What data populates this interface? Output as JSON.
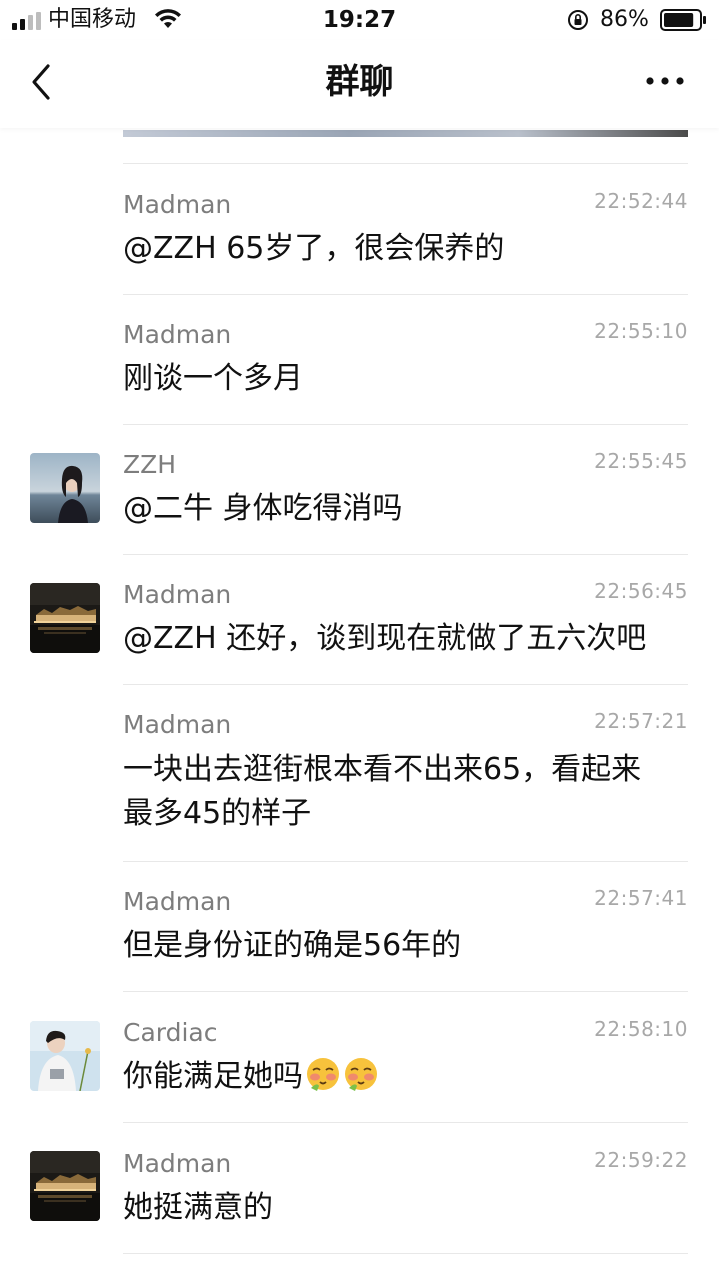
{
  "status_bar": {
    "carrier": "中国移动",
    "time": "19:27",
    "battery_percent": "86%",
    "battery_level": 0.86
  },
  "nav": {
    "title": "群聊",
    "back_icon": "chevron-left-icon",
    "more_icon": "more-dots-icon"
  },
  "messages": [
    {
      "sender": "Madman",
      "time": "22:52:44",
      "text": "@ZZH 65岁了，很会保养的",
      "avatar": "none"
    },
    {
      "sender": "Madman",
      "time": "22:55:10",
      "text": "刚谈一个多月",
      "avatar": "none"
    },
    {
      "sender": "ZZH",
      "time": "22:55:45",
      "text": "@二牛 身体吃得消吗",
      "avatar": "girl-beach-photo"
    },
    {
      "sender": "Madman",
      "time": "22:56:45",
      "text": "@ZZH 还好，谈到现在就做了五六次吧",
      "avatar": "night-palace-photo"
    },
    {
      "sender": "Madman",
      "time": "22:57:21",
      "text_line1": "一块出去逛街根本看不出来65，看起来",
      "text_line2": "最多45的样子",
      "avatar": "none"
    },
    {
      "sender": "Madman",
      "time": "22:57:41",
      "text": "但是身份证的确是56年的",
      "avatar": "none"
    },
    {
      "sender": "Cardiac",
      "time": "22:58:10",
      "text": "你能满足她吗",
      "emoji": [
        "blushing-emoji",
        "blushing-emoji"
      ],
      "avatar": "boy-photo"
    },
    {
      "sender": "Madman",
      "time": "22:59:22",
      "text": "她挺满意的",
      "avatar": "night-palace-photo"
    }
  ]
}
